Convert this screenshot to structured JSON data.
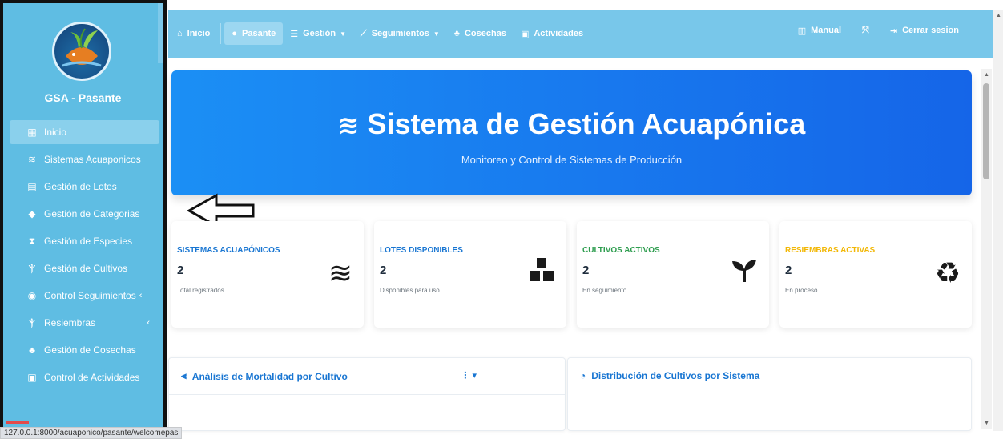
{
  "sidebar": {
    "brand": "GSA - Pasante",
    "items": [
      {
        "label": "Inicio",
        "icon": "grid-icon"
      },
      {
        "label": "Sistemas Acuaponicos",
        "icon": "water-waves-icon"
      },
      {
        "label": "Gestión de Lotes",
        "icon": "table-icon"
      },
      {
        "label": "Gestión de Categorias",
        "icon": "tags-icon"
      },
      {
        "label": "Gestión de Especies",
        "icon": "hourglass-icon"
      },
      {
        "label": "Gestión de Cultivos",
        "icon": "seedling-icon"
      },
      {
        "label": "Control Seguimientos",
        "icon": "eye-icon"
      },
      {
        "label": "Resiembras",
        "icon": "seedling-icon"
      },
      {
        "label": "Gestión de Cosechas",
        "icon": "people-carry-icon"
      },
      {
        "label": "Control de Actividades",
        "icon": "clipboard-icon"
      }
    ]
  },
  "topnav": {
    "inicio": "Inicio",
    "pasante": "Pasante",
    "gestion": "Gestión",
    "seguimientos": "Seguimientos",
    "cosechas": "Cosechas",
    "actividades": "Actividades",
    "manual": "Manual",
    "cerrar": "Cerrar sesion"
  },
  "hero": {
    "title": "Sistema de Gestión Acuapónica",
    "subtitle": "Monitoreo y Control de Sistemas de Producción"
  },
  "cards": [
    {
      "title": "SISTEMAS ACUAPÓNICOS",
      "value": "2",
      "note": "Total registrados",
      "color": "#1976d2",
      "icon": "water-waves-icon"
    },
    {
      "title": "LOTES DISPONIBLES",
      "value": "2",
      "note": "Disponibles para uso",
      "color": "#1976d2",
      "icon": "boxes-icon"
    },
    {
      "title": "CULTIVOS ACTIVOS",
      "value": "2",
      "note": "En seguimiento",
      "color": "#2e9d4f",
      "icon": "seedling-icon"
    },
    {
      "title": "RESIEMBRAS ACTIVAS",
      "value": "2",
      "note": "En proceso",
      "color": "#f2b705",
      "icon": "recycle-icon"
    }
  ],
  "panels": {
    "mortalidad": "Análisis de Mortalidad por Cultivo",
    "distribucion": "Distribución de Cultivos por Sistema"
  },
  "status_url": "127.0.0.1:8000/acuaponico/pasante/welcomepas"
}
